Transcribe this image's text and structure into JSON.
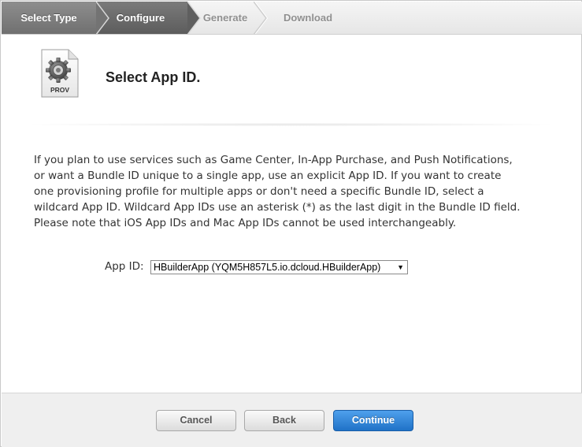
{
  "steps": [
    {
      "label": "Select Type",
      "state": "done"
    },
    {
      "label": "Configure",
      "state": "active"
    },
    {
      "label": "Generate",
      "state": "todo"
    },
    {
      "label": "Download",
      "state": "todo"
    }
  ],
  "header": {
    "icon_label": "PROV",
    "title": "Select App ID."
  },
  "description": "If you plan to use services such as Game Center, In-App Purchase, and Push Notifications, or want a Bundle ID unique to a single app, use an explicit App ID. If you want to create one provisioning profile for multiple apps or don't need a specific Bundle ID, select a wildcard App ID. Wildcard App IDs use an asterisk (*) as the last digit in the Bundle ID field. Please note that iOS App IDs and Mac App IDs cannot be used interchangeably.",
  "app_id": {
    "label": "App ID:",
    "selected": "HBuilderApp (YQM5H857L5.io.dcloud.HBuilderApp)"
  },
  "footer": {
    "cancel_label": "Cancel",
    "back_label": "Back",
    "continue_label": "Continue"
  },
  "colors": {
    "primary_button": "#2a7fd4",
    "step_active": "#6a6a6a"
  }
}
